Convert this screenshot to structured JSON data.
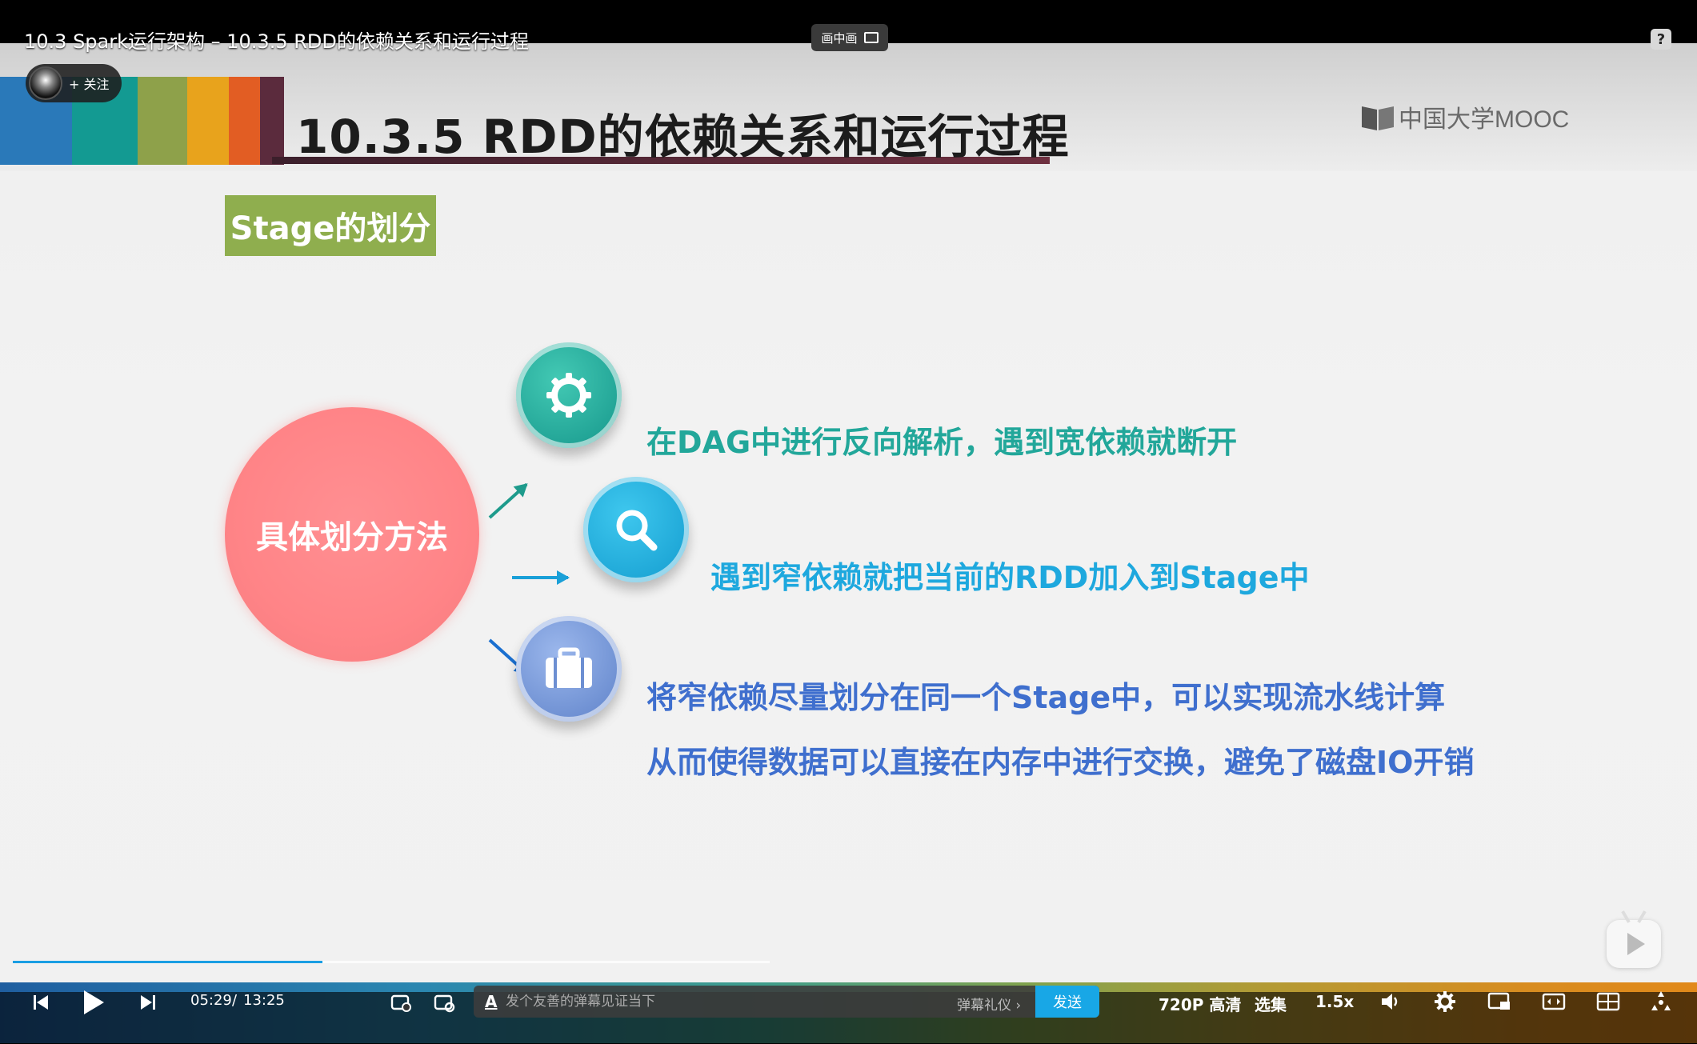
{
  "player": {
    "video_title": "10.3 Spark运行架构 – 10.3.5 RDD的依赖关系和运行过程",
    "pip_label": "画中画",
    "help_label": "?",
    "follow_label": "+ 关注",
    "time_current": "05:29",
    "time_separator": "/",
    "time_total": "13:25",
    "progress": 0.409,
    "danmaku": {
      "font_icon_label": "A",
      "placeholder": "发个友善的弹幕见证当下",
      "etiquette_label": "弹幕礼仪 ›",
      "send_label": "发送"
    },
    "quality_label": "720P 高清",
    "episodes_label": "选集",
    "speed_label": "1.5x"
  },
  "slide": {
    "title": "10.3.5  RDD的依赖关系和运行过程",
    "logo_text": "中国大学MOOC",
    "section_badge": "Stage的划分",
    "center_label": "具体划分方法",
    "items": [
      {
        "text": "在DAG中进行反向解析，遇到宽依赖就断开",
        "icon": "gear-icon"
      },
      {
        "text": "遇到窄依赖就把当前的RDD加入到Stage中",
        "icon": "search-icon"
      },
      {
        "text": "将窄依赖尽量划分在同一个Stage中，可以实现流水线计算",
        "icon": "briefcase-icon"
      }
    ],
    "item3_line2": "从而使得数据可以直接在内存中进行交换，避免了磁盘IO开销",
    "colors": {
      "stripes": [
        "#2a79b9",
        "#139a92",
        "#8ea14a",
        "#e8a31c",
        "#e25d23",
        "#b53a2c",
        "#5b2b3d"
      ],
      "accent_teal": "#22a79a",
      "accent_cyan": "#1ea8de",
      "accent_blue": "#3f6fce",
      "badge_green": "#8fae4e",
      "circle_pink": "#ff8487"
    }
  }
}
